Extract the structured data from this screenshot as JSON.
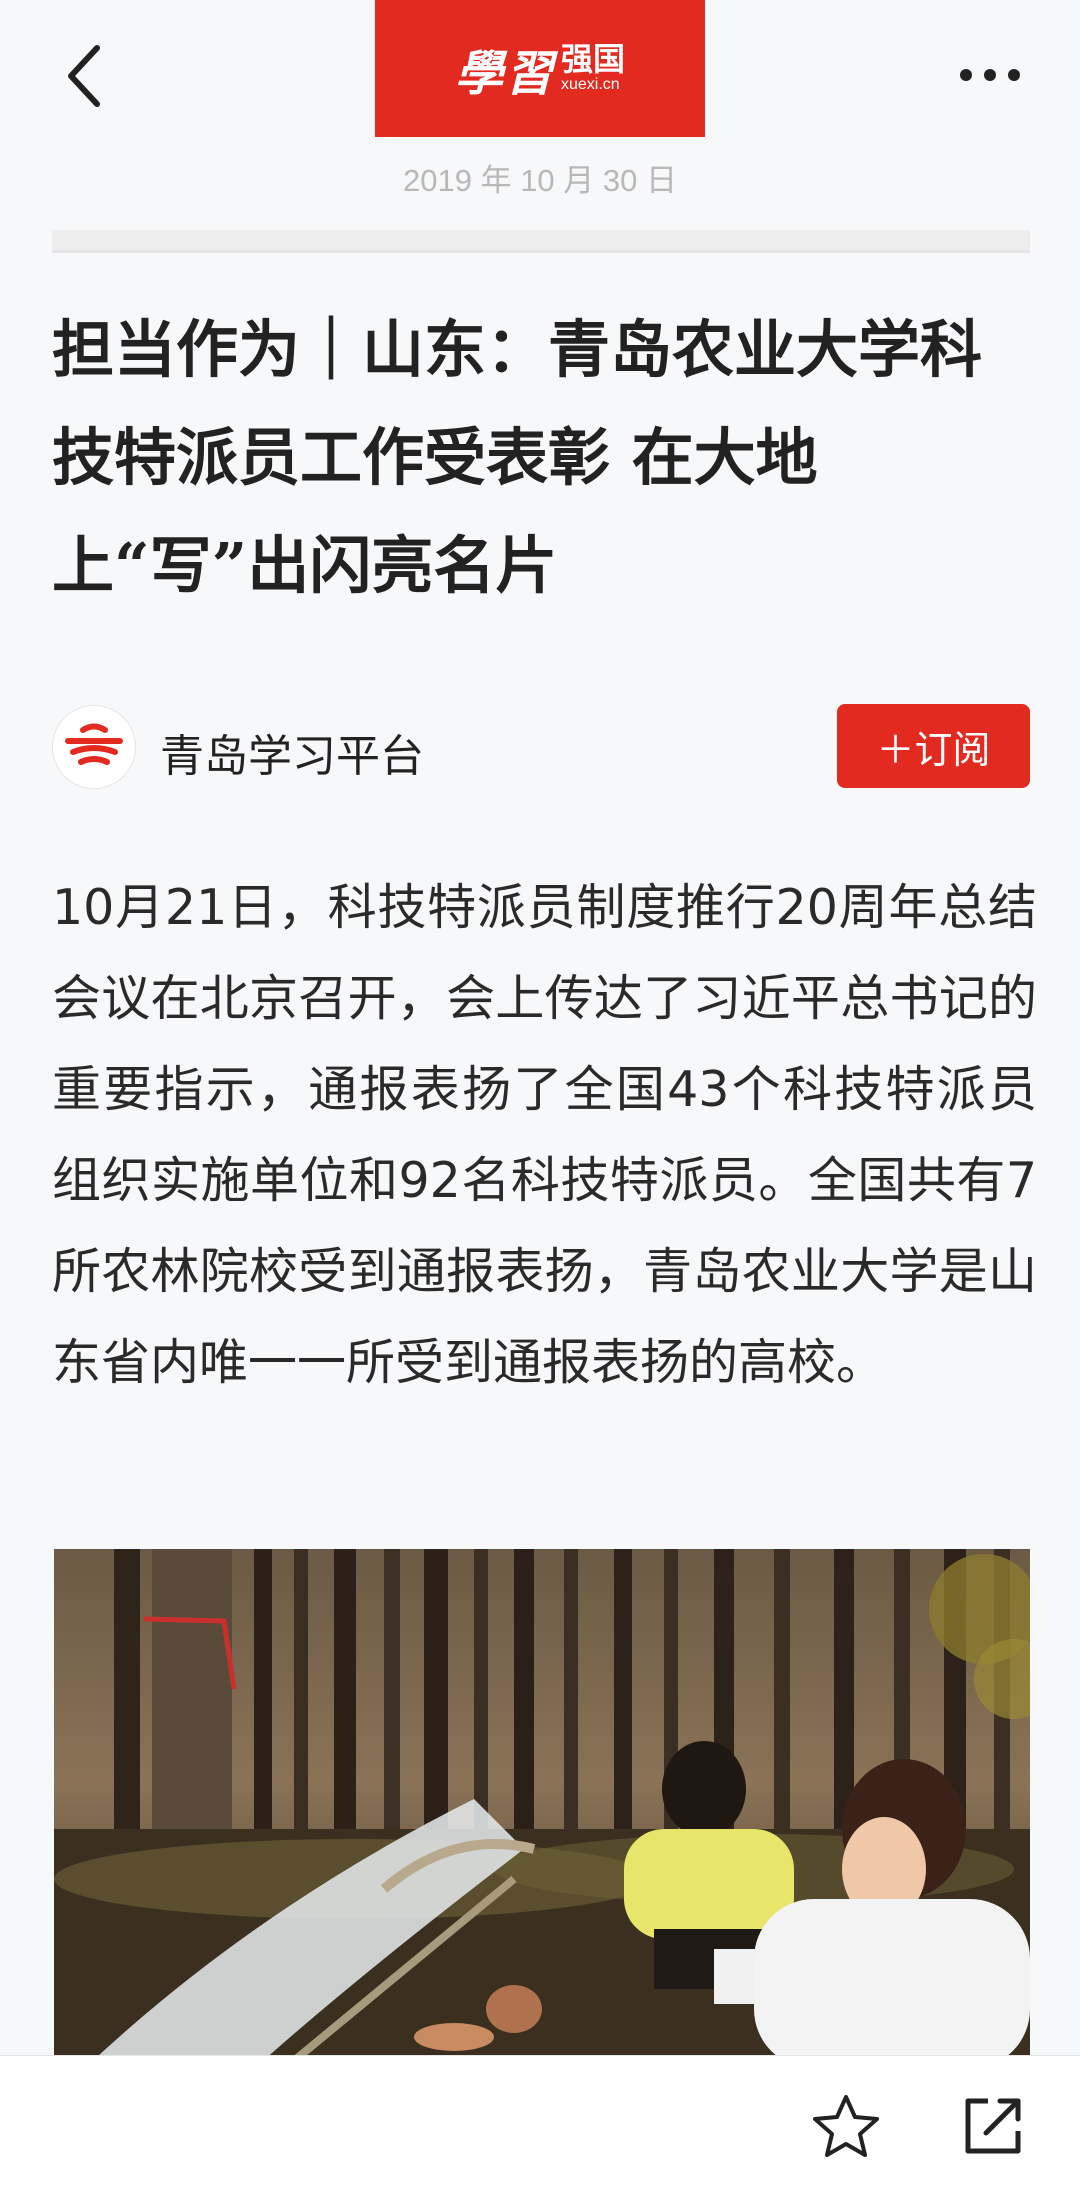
{
  "header": {
    "logo_main": "學習",
    "logo_name": "强国",
    "logo_domain": "xuexi.cn",
    "date": "2019 年 10 月 30 日"
  },
  "article": {
    "title": "担当作为｜山东：青岛农业大学科技特派员工作受表彰 在大地上“写”出闪亮名片",
    "body": "10月21日，科技特派员制度推行20周年总结会议在北京召开，会上传达了习近平总书记的重要指示，通报表扬了全国43个科技特派员组织实施单位和92名科技特派员。全国共有7所农林院校受到通报表扬，青岛农业大学是山东省内唯一一所受到通报表扬的高校。"
  },
  "author": {
    "name": "青岛学习平台",
    "subscribe_label": "＋订阅"
  },
  "icons": {
    "back": "chevron-left-icon",
    "more": "more-dots-icon",
    "favorite": "star-icon",
    "share": "share-external-icon"
  },
  "colors": {
    "brand_red": "#e22a21",
    "date_gray": "#b8b8b8",
    "background": "#f7f8fa"
  }
}
